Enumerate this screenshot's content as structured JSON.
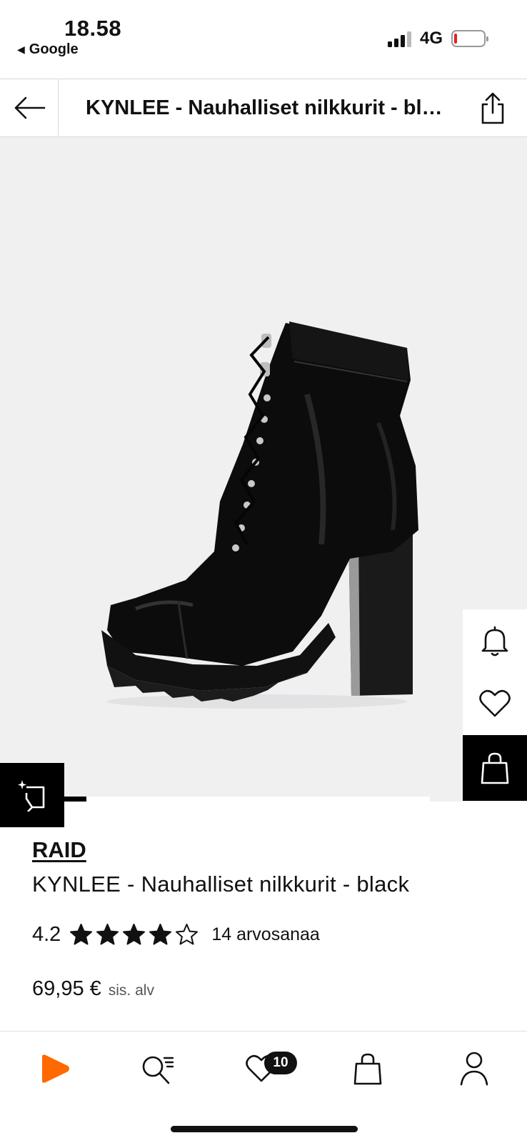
{
  "status": {
    "time": "18.58",
    "back_app": "Google",
    "network": "4G",
    "battery_level": 0.1,
    "battery_color": "#e22222"
  },
  "header": {
    "title": "KYNLEE - Nauhalliset nilkkurit - black"
  },
  "gallery": {
    "progress": 0.06,
    "background": "#f0f0f1"
  },
  "product": {
    "brand": "RAID",
    "name": "KYNLEE - Nauhalliset nilkkurit - black",
    "rating": {
      "value": "4.2",
      "stars_filled": 4,
      "stars_total": 5,
      "count_label": "14 arvosanaa"
    },
    "price": "69,95 €",
    "vat_note": "sis. alv"
  },
  "nav": {
    "wishlist_count": "10",
    "brand_color": "#ff6900"
  },
  "icons": [
    "back-arrow-icon",
    "share-icon",
    "bell-icon",
    "heart-icon",
    "bag-icon",
    "fit-icon",
    "home-icon",
    "search-icon",
    "wishlist-icon",
    "cart-icon",
    "profile-icon"
  ]
}
